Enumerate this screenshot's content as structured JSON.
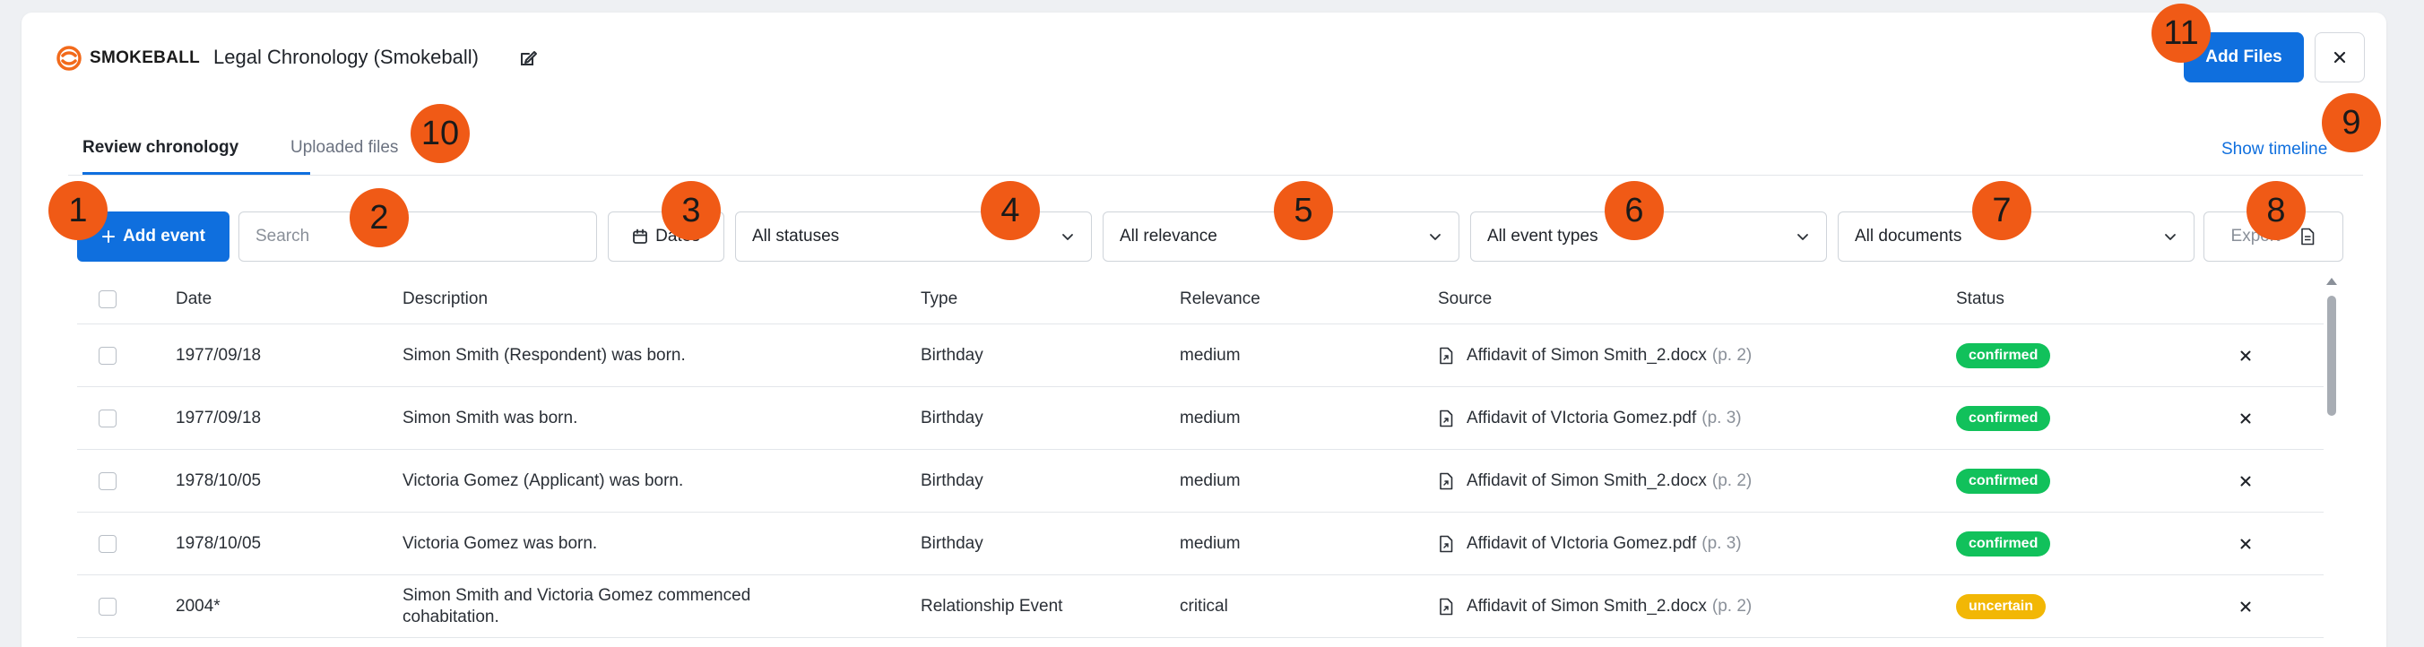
{
  "header": {
    "brand": "SMOKEBALL",
    "title": "Legal Chronology (Smokeball)",
    "add_files_label": "Add Files"
  },
  "tabs": [
    {
      "label": "Review chronology",
      "active": true
    },
    {
      "label": "Uploaded files",
      "active": false
    }
  ],
  "show_timeline_label": "Show timeline",
  "toolbar": {
    "add_event_label": "Add event",
    "search_placeholder": "Search",
    "dates_label": "Dates",
    "statuses": "All statuses",
    "relevance": "All relevance",
    "event_types": "All event types",
    "documents": "All documents",
    "export_label": "Export"
  },
  "table": {
    "columns": [
      "Date",
      "Description",
      "Type",
      "Relevance",
      "Source",
      "Status"
    ],
    "rows": [
      {
        "date": "1977/09/18",
        "description": "Simon Smith (Respondent) was born.",
        "type": "Birthday",
        "relevance": "medium",
        "source": "Affidavit of Simon Smith_2.docx",
        "page": "(p. 2)",
        "status": "confirmed"
      },
      {
        "date": "1977/09/18",
        "description": "Simon Smith was born.",
        "type": "Birthday",
        "relevance": "medium",
        "source": "Affidavit of VIctoria Gomez.pdf",
        "page": "(p. 3)",
        "status": "confirmed"
      },
      {
        "date": "1978/10/05",
        "description": "Victoria Gomez (Applicant) was born.",
        "type": "Birthday",
        "relevance": "medium",
        "source": "Affidavit of Simon Smith_2.docx",
        "page": "(p. 2)",
        "status": "confirmed"
      },
      {
        "date": "1978/10/05",
        "description": "Victoria Gomez was born.",
        "type": "Birthday",
        "relevance": "medium",
        "source": "Affidavit of VIctoria Gomez.pdf",
        "page": "(p. 3)",
        "status": "confirmed"
      },
      {
        "date": "2004*",
        "description": "Simon Smith and Victoria Gomez commenced cohabitation.",
        "type": "Relationship Event",
        "relevance": "critical",
        "source": "Affidavit of Simon Smith_2.docx",
        "page": "(p. 2)",
        "status": "uncertain"
      }
    ]
  },
  "markers": [
    "1",
    "2",
    "3",
    "4",
    "5",
    "6",
    "7",
    "8",
    "9",
    "10",
    "11"
  ],
  "colors": {
    "primary": "#0f6fde",
    "confirmed": "#11c15b",
    "uncertain": "#f2b705",
    "marker": "#f05a16",
    "brand_orange": "#f26a1b"
  }
}
